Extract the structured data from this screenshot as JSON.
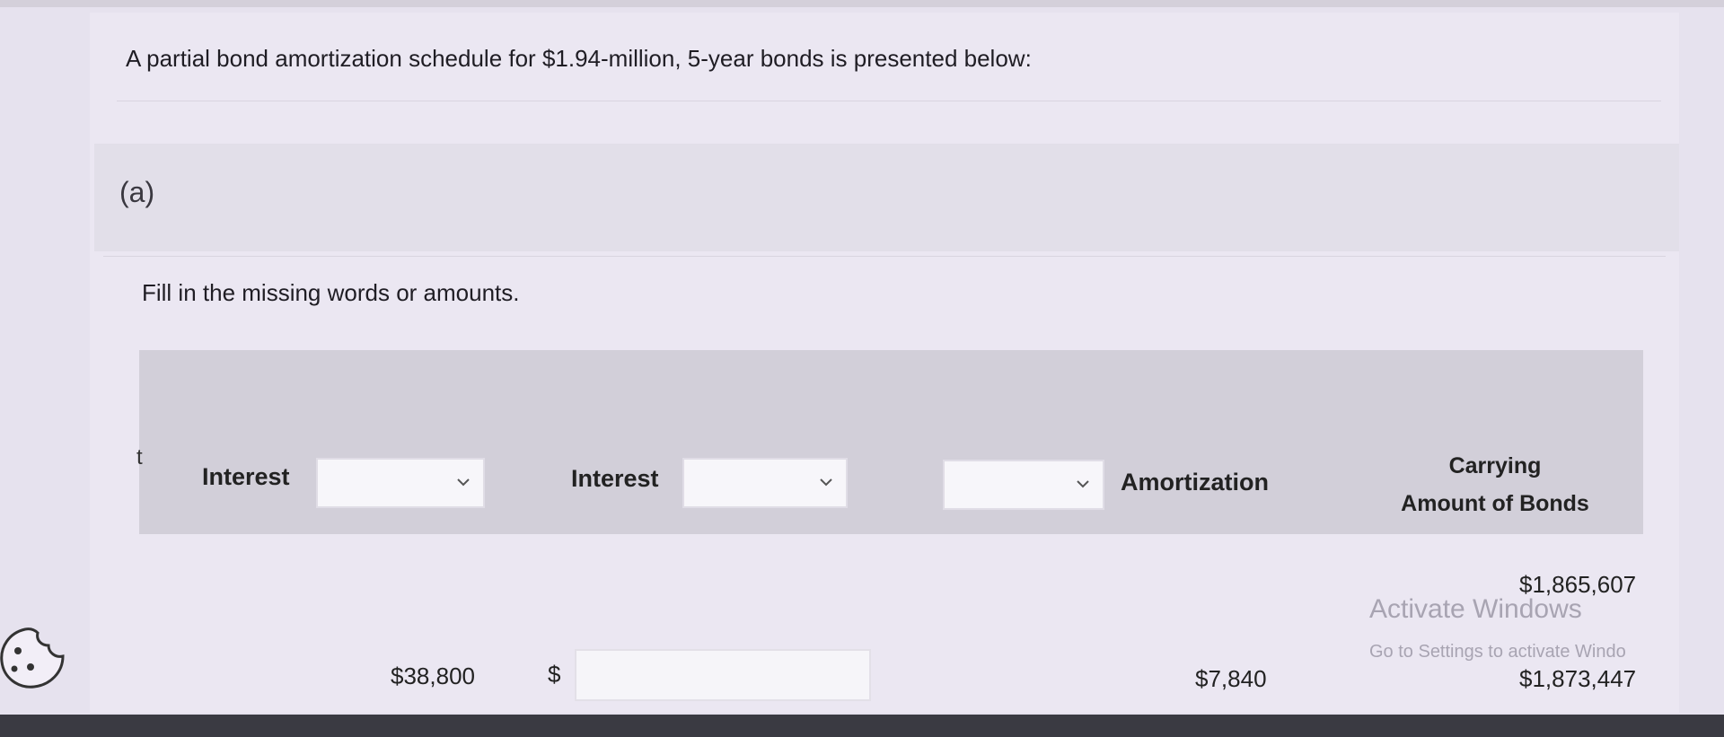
{
  "intro": "A partial bond amortization schedule for $1.94-million, 5-year bonds is presented below:",
  "section_label": "(a)",
  "instruction": "Fill in the missing words or amounts.",
  "table": {
    "stub_fragment": "t",
    "headers": {
      "col1": "Interest",
      "col2": "Interest",
      "col3": "Amortization",
      "col4_line1": "Carrying",
      "col4_line2": "Amount of Bonds"
    },
    "dropdowns": {
      "col1": "",
      "col2": "",
      "col3": ""
    },
    "rows": [
      {
        "carrying": "$1,865,607"
      },
      {
        "interest1": "$38,800",
        "currency": "$",
        "interest2": "",
        "amortization": "$7,840",
        "carrying": "$1,873,447"
      }
    ]
  },
  "watermark": {
    "title": "Activate Windows",
    "subtitle": "Go to Settings to activate Windo"
  },
  "icons": {
    "cookie": "cookie-icon",
    "chevron": "chevron-down-icon"
  },
  "colors": {
    "page": "#e6e2ee",
    "panel": "#ebe7f2",
    "header_band": "#d2cfd9"
  }
}
